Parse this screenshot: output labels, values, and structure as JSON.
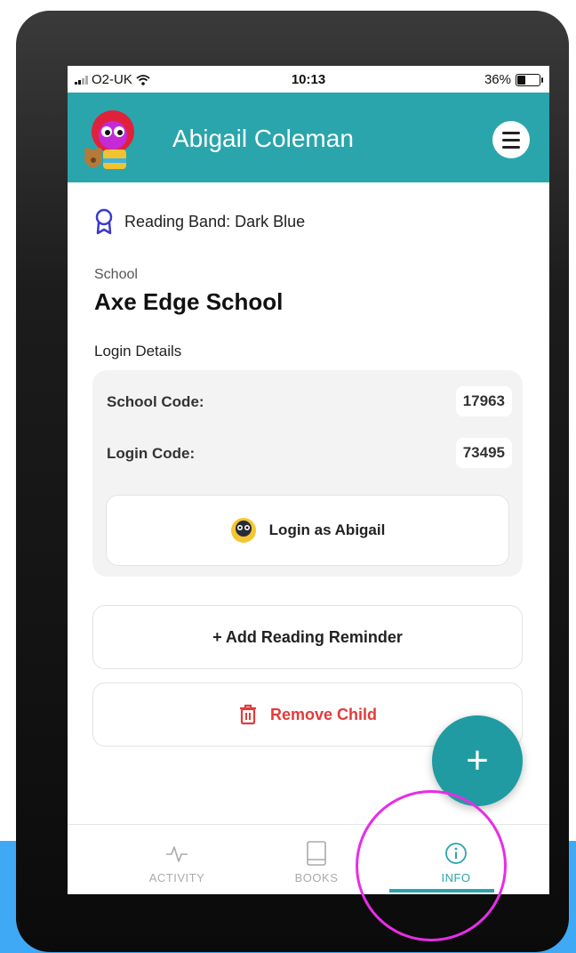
{
  "status_bar": {
    "carrier": "O2-UK",
    "time": "10:13",
    "battery": "36%"
  },
  "header": {
    "title": "Abigail Coleman"
  },
  "profile": {
    "reading_band": "Reading Band: Dark Blue",
    "school_label": "School",
    "school_name": "Axe Edge School",
    "login_heading": "Login Details",
    "school_code_label": "School Code:",
    "school_code_value": "17963",
    "login_code_label": "Login Code:",
    "login_code_value": "73495",
    "login_as_label": "Login as Abigail"
  },
  "actions": {
    "add_reminder_label": "+ Add Reading Reminder",
    "remove_child_label": "Remove Child",
    "fab_label": "+"
  },
  "tabs": [
    {
      "label": "ACTIVITY",
      "icon": "activity-icon",
      "active": false
    },
    {
      "label": "BOOKS",
      "icon": "book-icon",
      "active": false
    },
    {
      "label": "INFO",
      "icon": "info-icon",
      "active": true
    }
  ],
  "colors": {
    "accent": "#2aa5ab",
    "danger": "#e23b3b",
    "highlight_ring": "#e62ee6",
    "page_bottom": "#3fa9f5"
  }
}
